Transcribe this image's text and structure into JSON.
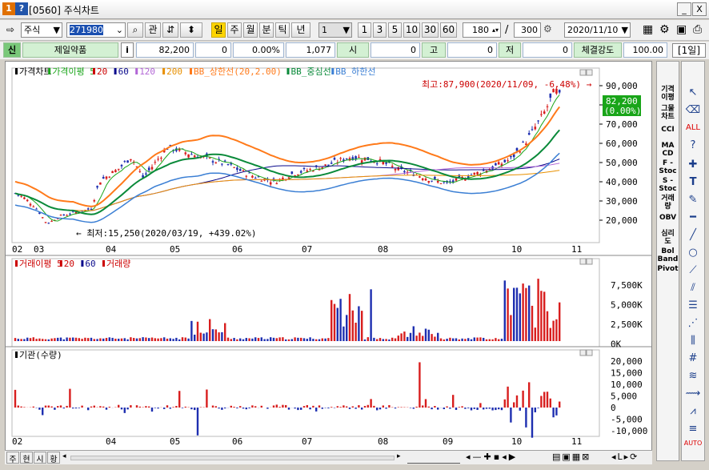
{
  "window": {
    "id": "0560",
    "title": "주식차트",
    "minimize": "_",
    "close": "X"
  },
  "toolbar": {
    "market": "주식",
    "code": "271980",
    "btn_kwan": "관",
    "periods": [
      "일",
      "주",
      "월",
      "분",
      "틱",
      "년"
    ],
    "period_selected": "일",
    "interval_value": "1",
    "intervals": [
      "1",
      "3",
      "5",
      "10",
      "30",
      "60"
    ],
    "count": "180",
    "slash": "/",
    "total": "300",
    "date": "2020/11/10"
  },
  "quote": {
    "badge": "신",
    "name": "제일약품",
    "info": "i",
    "price": "82,200",
    "change": "0",
    "rate": "0.00%",
    "volume": "1,077",
    "open_label": "시",
    "open": "0",
    "high_label": "고",
    "high": "0",
    "low_label": "저",
    "low": "0",
    "strength_label": "체결강도",
    "strength": "100.00",
    "period_tag": "[1일]"
  },
  "price_panel": {
    "legend": [
      {
        "text": "가격차트",
        "color": "#000000"
      },
      {
        "text": "가격이평 5",
        "color": "#19a519"
      },
      {
        "text": "20",
        "color": "#cc0000"
      },
      {
        "text": "60",
        "color": "#0a0a8c"
      },
      {
        "text": "120",
        "color": "#b266d6"
      },
      {
        "text": "200",
        "color": "#e89000"
      },
      {
        "text": "BB_상한선(20,2.00)",
        "color": "#ff7a1a"
      },
      {
        "text": "BB_중심선",
        "color": "#0a8a3a"
      },
      {
        "text": "BB_하한선",
        "color": "#3b7fd4"
      }
    ],
    "max_note": "최고:87,900(2020/11/09, -6.48%)",
    "min_note": "최저:15,250(2020/03/19, +439.02%)",
    "current": "82,200",
    "current_pct": "(0.00%)",
    "y_ticks": [
      "90,000",
      "80,000",
      "70,000",
      "60,000",
      "50,000",
      "40,000",
      "30,000",
      "20,000"
    ]
  },
  "volume_panel": {
    "legend": [
      {
        "text": "거래이평 5",
        "color": "#cc0000"
      },
      {
        "text": "20",
        "color": "#cc0000"
      },
      {
        "text": "60",
        "color": "#0a0a8c"
      },
      {
        "text": "거래량",
        "color": "#cc0000"
      }
    ],
    "y_ticks": [
      "7,500K",
      "5,000K",
      "2,500K",
      "0K"
    ]
  },
  "inst_panel": {
    "legend": [
      {
        "text": "기관(수량)",
        "color": "#000000"
      }
    ],
    "y_ticks": [
      "20,000",
      "15,000",
      "10,000",
      "5,000",
      "0",
      "-5,000",
      "-10,000"
    ]
  },
  "x_labels": [
    "02",
    "03",
    "04",
    "05",
    "06",
    "07",
    "08",
    "09",
    "10",
    "11"
  ],
  "x_labels_bottom": [
    "02",
    "04",
    "05",
    "06",
    "07",
    "08",
    "09",
    "10",
    "11"
  ],
  "bottom_tabs": [
    "주",
    "현",
    "시",
    "황"
  ],
  "right_tools": [
    "기격\n이평",
    "그물\n차트",
    "CCI",
    "MA\nCD",
    "F -\nStoc",
    "S -\nStoc",
    "거래\n량",
    "OBV",
    "심리\n도",
    "Bol\nBand",
    "Pivot"
  ],
  "colors": {
    "up": "#d81e1e",
    "down": "#1e2fb0",
    "accent": "#ffd500",
    "quote_label_bg": "#d3f0d3"
  }
}
